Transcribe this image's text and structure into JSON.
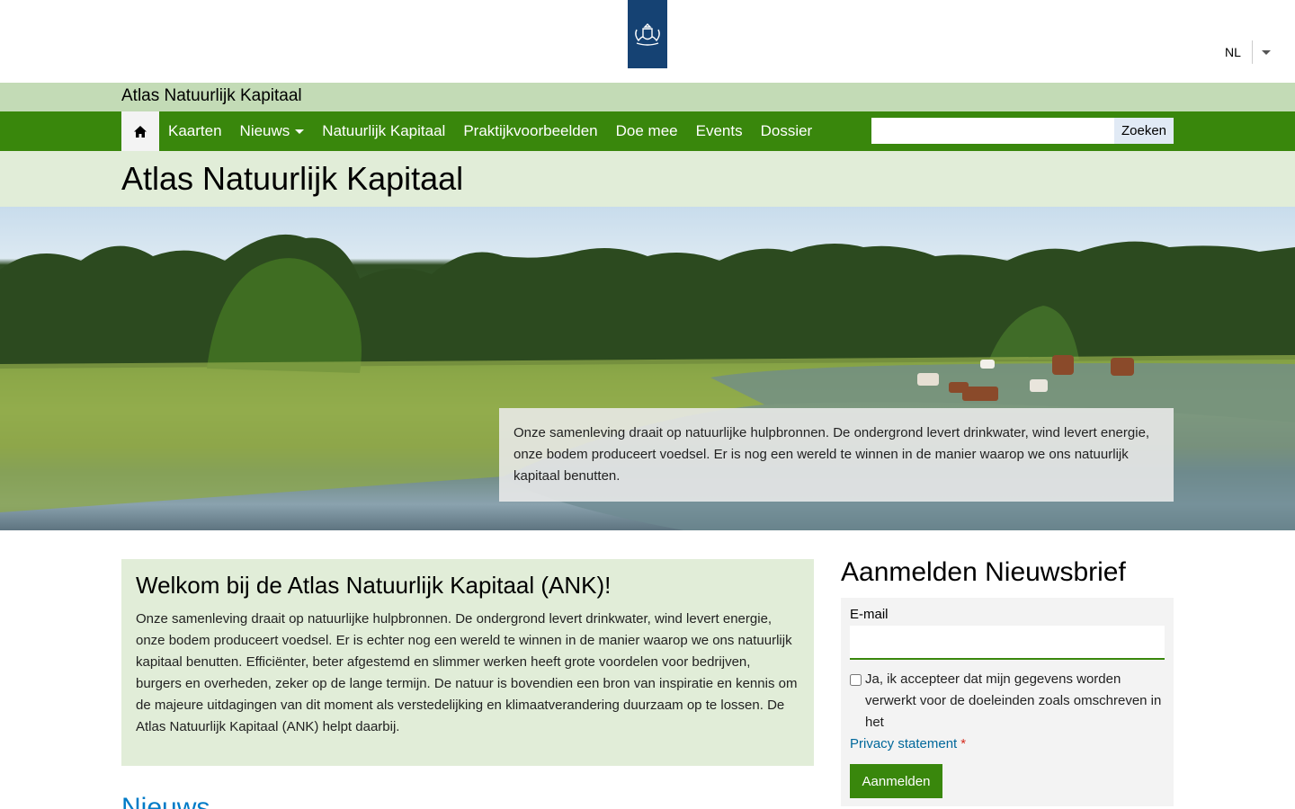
{
  "header": {
    "logo_icon": "rijksoverheid-crest-icon",
    "language": "NL"
  },
  "site": {
    "name": "Atlas Natuurlijk Kapitaal"
  },
  "nav": {
    "home_icon": "home-icon",
    "items": [
      {
        "label": "Kaarten"
      },
      {
        "label": "Nieuws",
        "has_dropdown": true
      },
      {
        "label": "Natuurlijk Kapitaal"
      },
      {
        "label": "Praktijkvoorbeelden"
      },
      {
        "label": "Doe mee"
      },
      {
        "label": "Events"
      },
      {
        "label": "Dossier"
      }
    ],
    "search_value": "",
    "search_button": "Zoeken"
  },
  "page": {
    "title": "Atlas Natuurlijk Kapitaal"
  },
  "hero": {
    "text": "Onze samenleving draait op natuurlijke hulpbronnen. De ondergrond levert drinkwater, wind levert energie, onze bodem produceert voedsel. Er is nog een wereld te winnen in de manier waarop we ons natuurlijk kapitaal benutten."
  },
  "welcome": {
    "title": "Welkom bij de Atlas Natuurlijk Kapitaal (ANK)!",
    "text": "Onze samenleving draait op natuurlijke hulpbronnen. De ondergrond levert drinkwater, wind levert energie, onze bodem produceert voedsel. Er is echter nog een wereld te winnen in de manier waarop we ons natuurlijk kapitaal benutten. Efficiënter, beter afgestemd en slimmer werken heeft grote voordelen voor bedrijven, burgers en overheden, zeker op de lange termijn. De natuur is bovendien een bron van inspiratie en kennis om de majeure uitdagingen van dit moment als verstedelijking en klimaatverandering duurzaam op te lossen. De Atlas Natuurlijk Kapitaal (ANK) helpt daarbij."
  },
  "news": {
    "heading": "Nieuws"
  },
  "newsletter": {
    "title": "Aanmelden Nieuwsbrief",
    "email_label": "E-mail",
    "email_value": "",
    "consent_text": "Ja, ik accepteer dat mijn gegevens worden verwerkt voor de doeleinden zoals omschreven in het",
    "privacy_link": "Privacy statement",
    "required_marker": "*",
    "submit": "Aanmelden"
  },
  "colors": {
    "brand_green": "#39870c",
    "light_green": "#c3dbb6",
    "pale_green": "#e1edd8",
    "logo_blue": "#154273",
    "link_blue": "#01689b"
  }
}
